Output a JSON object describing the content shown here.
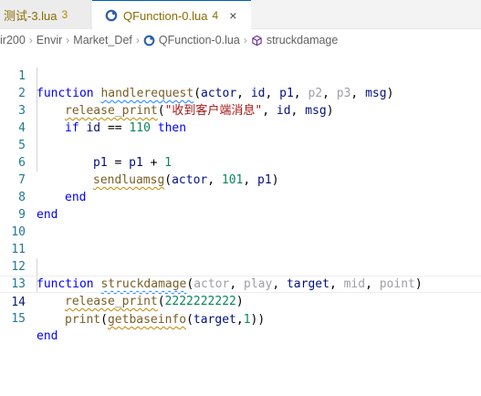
{
  "tabs": [
    {
      "label": "测试-3.lua",
      "count": "3"
    },
    {
      "label": "QFunction-0.lua",
      "count": "4",
      "close": "×"
    }
  ],
  "breadcrumb": {
    "items": [
      "ir200",
      "Envir",
      "Market_Def",
      "QFunction-0.lua",
      "struckdamage"
    ],
    "separator": "›"
  },
  "editor": {
    "line_numbers": [
      "1",
      "2",
      "3",
      "4",
      "5",
      "6",
      "7",
      "8",
      "9",
      "10",
      "11",
      "12",
      "13",
      "14",
      "15"
    ],
    "lines": {
      "l1": [
        "function",
        " ",
        "handlerequest",
        "(",
        "actor",
        ", ",
        "id",
        ", ",
        "p1",
        ", ",
        "p2",
        ", ",
        "p3",
        ", ",
        "msg",
        ")"
      ],
      "l2": [
        "release_print",
        "(",
        "\"收到客户端消息\"",
        ", ",
        "id",
        ", ",
        "msg",
        ")"
      ],
      "l3": [
        "if",
        " ",
        "id",
        " == ",
        "110",
        " ",
        "then"
      ],
      "l5": [
        "p1",
        " = ",
        "p1",
        " + ",
        "1"
      ],
      "l6": [
        "sendluamsg",
        "(",
        "actor",
        ", ",
        "101",
        ", ",
        "p1",
        ")"
      ],
      "l7": [
        "end"
      ],
      "l8": [
        "end"
      ],
      "l12": [
        "function",
        " ",
        "struckdamage",
        "(",
        "actor",
        ", ",
        "play",
        ", ",
        "target",
        ", ",
        "mid",
        ", ",
        "point",
        ")"
      ],
      "l13": [
        "release_print",
        "(",
        "2222222222",
        ")"
      ],
      "l14": [
        "print",
        "(",
        "getbaseinfo",
        "(",
        "target",
        ",",
        "1",
        "))"
      ],
      "l15": [
        "end"
      ]
    }
  },
  "colors": {
    "keyword": "#0000ff",
    "function": "#795e26",
    "identifier": "#001080",
    "string": "#a31515",
    "number": "#098658",
    "unused_param": "#9e9ea8",
    "line_number": "#237893",
    "active_tab_border": "#005fb8"
  }
}
